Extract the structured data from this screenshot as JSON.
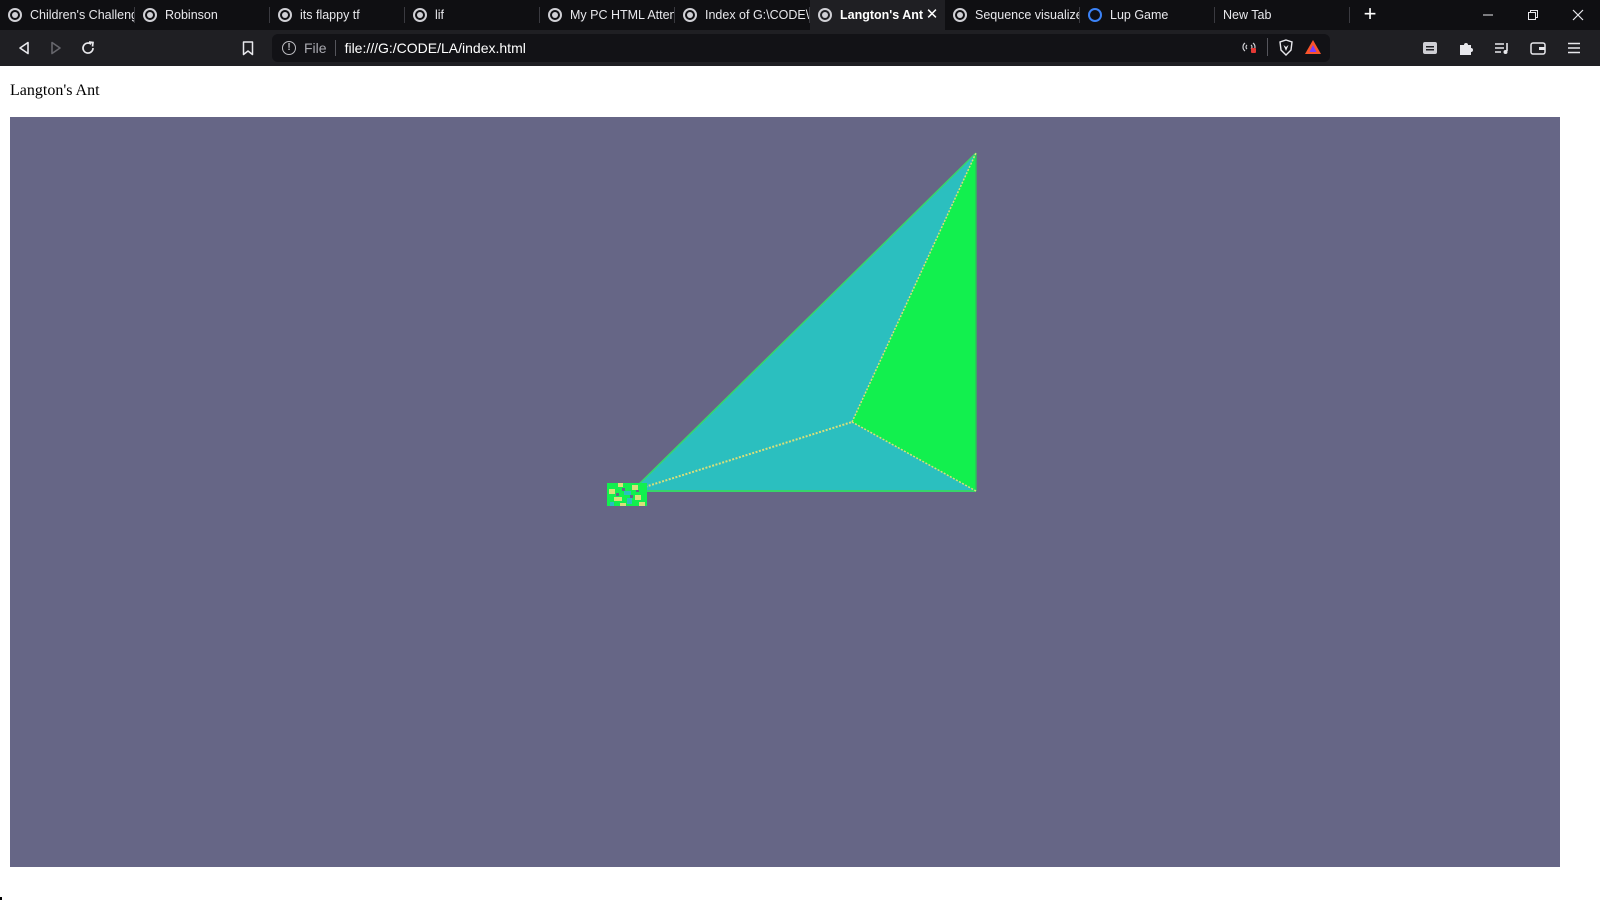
{
  "browser": {
    "tabs": [
      {
        "title": "Children's Challeng",
        "favicon": "globe-icon",
        "active": false
      },
      {
        "title": "Robinson",
        "favicon": "globe-icon",
        "active": false
      },
      {
        "title": "its flappy tf",
        "favicon": "globe-icon",
        "active": false
      },
      {
        "title": "lif",
        "favicon": "globe-icon",
        "active": false
      },
      {
        "title": "My PC HTML Atten",
        "favicon": "globe-icon",
        "active": false
      },
      {
        "title": "Index of G:\\CODE\\",
        "favicon": "globe-icon",
        "active": false
      },
      {
        "title": "Langton's Ant",
        "favicon": "globe-icon",
        "active": true
      },
      {
        "title": "Sequence visualize",
        "favicon": "globe-icon",
        "active": false
      },
      {
        "title": "Lup Game",
        "favicon": "loading-icon",
        "active": false
      },
      {
        "title": "New Tab",
        "favicon": "none",
        "active": false
      }
    ],
    "new_tab_glyph": "+",
    "close_glyph": "✕",
    "window_buttons": {
      "minimize": "—",
      "restore": "❐",
      "close": "✕"
    },
    "nav": {
      "back": "back-icon",
      "forward": "forward-icon",
      "reload": "reload-icon"
    },
    "address_bar": {
      "info_glyph": "!",
      "scheme_label": "File",
      "url": "file:///G:/CODE/LA/index.html"
    },
    "accent_brave": "#fb542b"
  },
  "page": {
    "heading": "Langton's Ant",
    "canvas_background": "#666686",
    "shape_colors": {
      "teal": "#2bbfbf",
      "green": "#12f04e",
      "outline": "#d7e07a"
    }
  }
}
